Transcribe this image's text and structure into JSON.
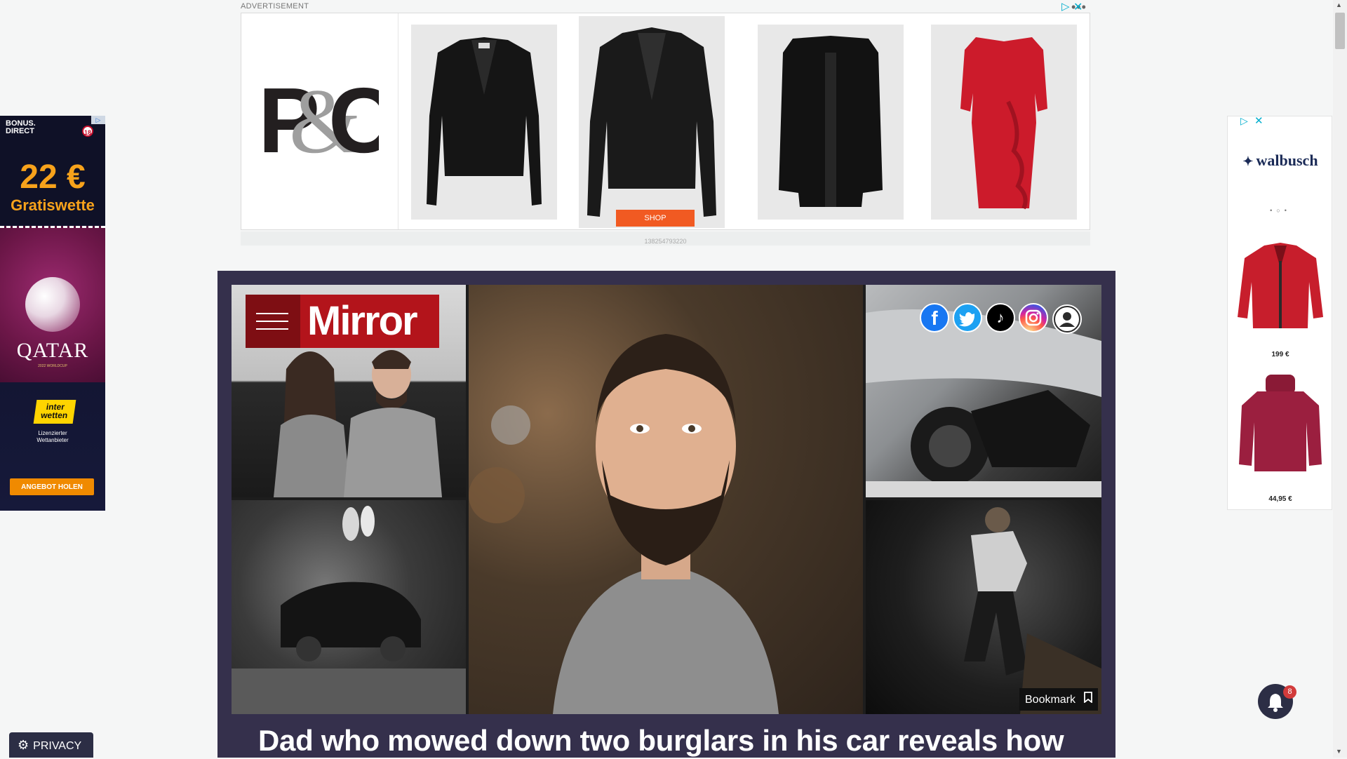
{
  "top_ad": {
    "label": "ADVERTISEMENT",
    "menu_dots": "•••",
    "brand": "P&C",
    "shop_label": "SHOP",
    "ad_id": "138254793220",
    "adchoices_icon": "▷",
    "close_icon": "✕"
  },
  "left_ad": {
    "brand": "BONUS.\nDIRECT",
    "age_badge": "18",
    "bonus_amount": "22 €",
    "bonus_text": "Gratiswette",
    "event": "QATAR",
    "event_sub": "2022 WORLDCUP",
    "sponsor": "inter\nwetten",
    "license": "Lizenzierter\nWettanbieter",
    "cta": "ANGEBOT HOLEN"
  },
  "right_ad": {
    "brand": "walbusch",
    "carousel_dots": "•○•",
    "price_1": "199 €",
    "price_2": "44,95 €",
    "adchoices_icon": "▷",
    "close_icon": "✕"
  },
  "site": {
    "logo": "Mirror",
    "social": {
      "facebook": "f",
      "tiktok": "♪"
    },
    "bookmark_label": "Bookmark",
    "headline": "Dad who mowed down two burglars in his car reveals how",
    "notification_count": "8",
    "privacy_label": "PRIVACY"
  },
  "colors": {
    "mirror_red": "#b3141b",
    "hero_bg": "#35304c",
    "shop_orange": "#f15a22"
  }
}
